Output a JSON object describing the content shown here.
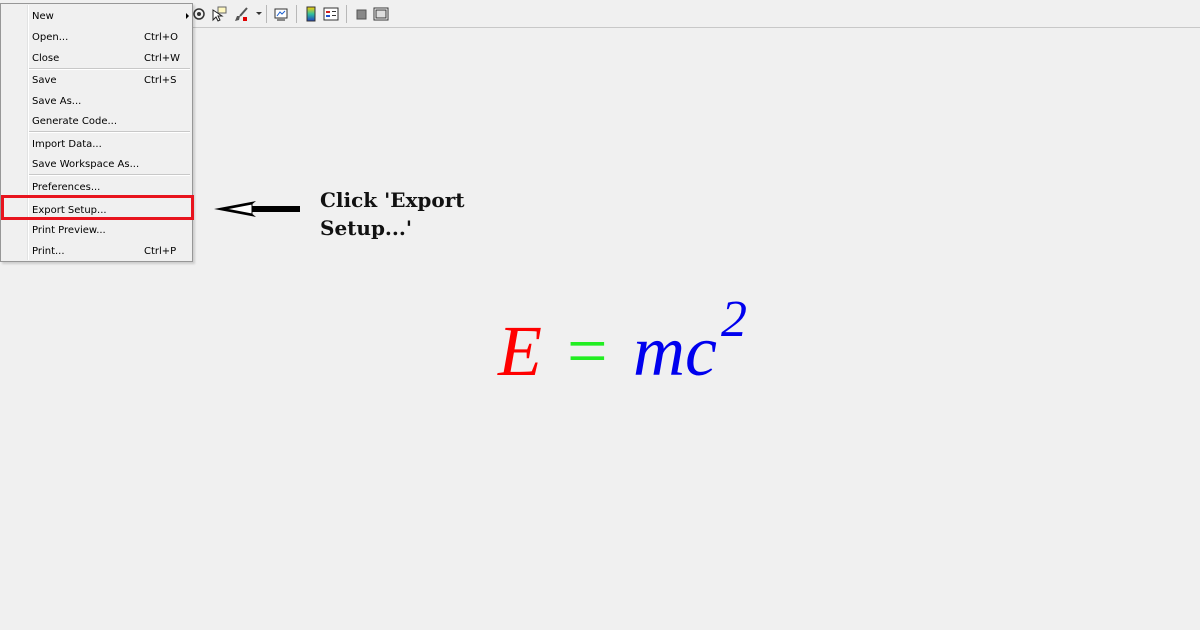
{
  "menu": {
    "items": [
      {
        "label": "New",
        "shortcut": "",
        "has_submenu": true
      },
      {
        "label": "Open...",
        "shortcut": "Ctrl+O"
      },
      {
        "label": "Close",
        "shortcut": "Ctrl+W"
      },
      {
        "label": "Save",
        "shortcut": "Ctrl+S"
      },
      {
        "label": "Save As...",
        "shortcut": ""
      },
      {
        "label": "Generate Code...",
        "shortcut": ""
      },
      {
        "label": "Import Data...",
        "shortcut": ""
      },
      {
        "label": "Save Workspace As...",
        "shortcut": ""
      },
      {
        "label": "Preferences...",
        "shortcut": ""
      },
      {
        "label": "Export Setup...",
        "shortcut": "",
        "highlighted": true
      },
      {
        "label": "Print Preview...",
        "shortcut": ""
      },
      {
        "label": "Print...",
        "shortcut": "Ctrl+P"
      }
    ]
  },
  "annotation": {
    "line1": "Click 'Export",
    "line2": "Setup...'",
    "highlight_color": "#e8141e"
  },
  "equation": {
    "e": "E",
    "equals": "=",
    "mc": "mc",
    "exponent": "2",
    "color_e": "#ff0000",
    "color_equals": "#22ee22",
    "color_mc": "#0000ee"
  },
  "toolbar": {
    "icons": [
      "rotate-3d-icon",
      "data-cursor-icon",
      "brush-icon",
      "link-plot-icon",
      "colorbar-icon",
      "legend-icon",
      "hide-plot-tools-icon",
      "show-plot-tools-icon"
    ]
  }
}
